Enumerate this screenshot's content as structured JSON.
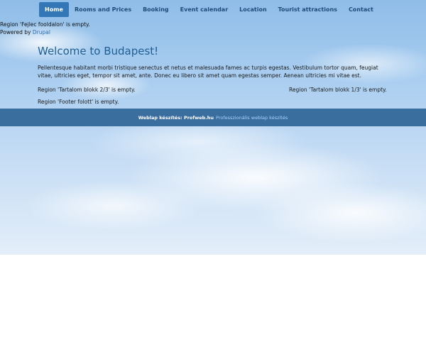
{
  "nav": {
    "items": [
      {
        "label": "Home",
        "active": true
      },
      {
        "label": "Rooms and Prices",
        "active": false
      },
      {
        "label": "Booking",
        "active": false
      },
      {
        "label": "Event calendar",
        "active": false
      },
      {
        "label": "Location",
        "active": false
      },
      {
        "label": "Tourist attractions",
        "active": false
      },
      {
        "label": "Contact",
        "active": false
      }
    ]
  },
  "header": {
    "region_empty": "Region 'Fejlec fooldalon' is empty.",
    "powered_by": "Powered by",
    "powered_link": "Drupal"
  },
  "main": {
    "title": "Welcome to Budapest!",
    "intro": "Pellentesque habitant morbi tristique senectus et netus et malesuada fames ac turpis egestas. Vestibulum tortor quam, feugiat vitae, ultricies eget, tempor sit amet, ante. Donec eu libero sit amet quam egestas semper. Aenean ultricies mi vitae est.",
    "block_left": "Region 'Tartalom blokk 2/3' is empty.",
    "block_right": "Region 'Tartalom blokk 1/3' is empty.",
    "footer_region": "Region 'Footer folott' is empty."
  },
  "footer": {
    "credit_prefix": "Weblap készítés: Profweb.hu",
    "credit_link": "Professzionális weblap készítés"
  },
  "colors": {
    "nav_active_bg": "#3477b6",
    "nav_text": "#1d4c7a",
    "title": "#1e5e93",
    "footer_bg": "#3a6e9f",
    "link": "#2a6db0"
  }
}
